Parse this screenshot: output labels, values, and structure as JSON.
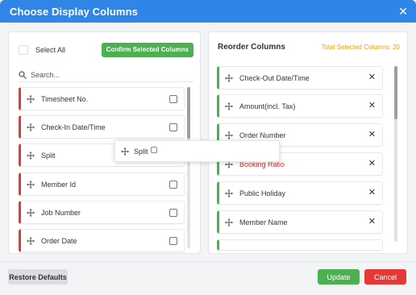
{
  "window": {
    "title": "Choose Display Columns",
    "close_glyph": "✕"
  },
  "left_panel": {
    "select_all_label": "Select All",
    "confirm_button": "Confirm Selected Columns",
    "search_placeholder": "Search...",
    "items": [
      {
        "label": "Timesheet No."
      },
      {
        "label": "Check-In Date/Time"
      },
      {
        "label": "Split"
      },
      {
        "label": "Member Id"
      },
      {
        "label": "Job Number"
      },
      {
        "label": "Order Date"
      }
    ]
  },
  "right_panel": {
    "title": "Reorder Columns",
    "total_label": "Total Selected Columns: 20",
    "items": [
      {
        "label": "Check-Out Date/Time"
      },
      {
        "label": "Amount(incl. Tax)"
      },
      {
        "label": "Order Number"
      },
      {
        "label": "Booking Ratio"
      },
      {
        "label": "Public Holiday"
      },
      {
        "label": "Member Name"
      }
    ]
  },
  "drag_ghost": {
    "label": "Split"
  },
  "footer": {
    "restore_button": "Restore Defaults",
    "update_button": "Update",
    "cancel_button": "Cancel"
  },
  "colors": {
    "header": "#2f86e6",
    "confirm": "#4caf50",
    "left_accent": "#e53935",
    "right_accent": "#4caf50",
    "total": "#f39c12",
    "cancel": "#e53935"
  },
  "icons": {
    "search": "search-icon",
    "move": "move-icon",
    "remove": "x-icon",
    "close": "close-icon"
  }
}
